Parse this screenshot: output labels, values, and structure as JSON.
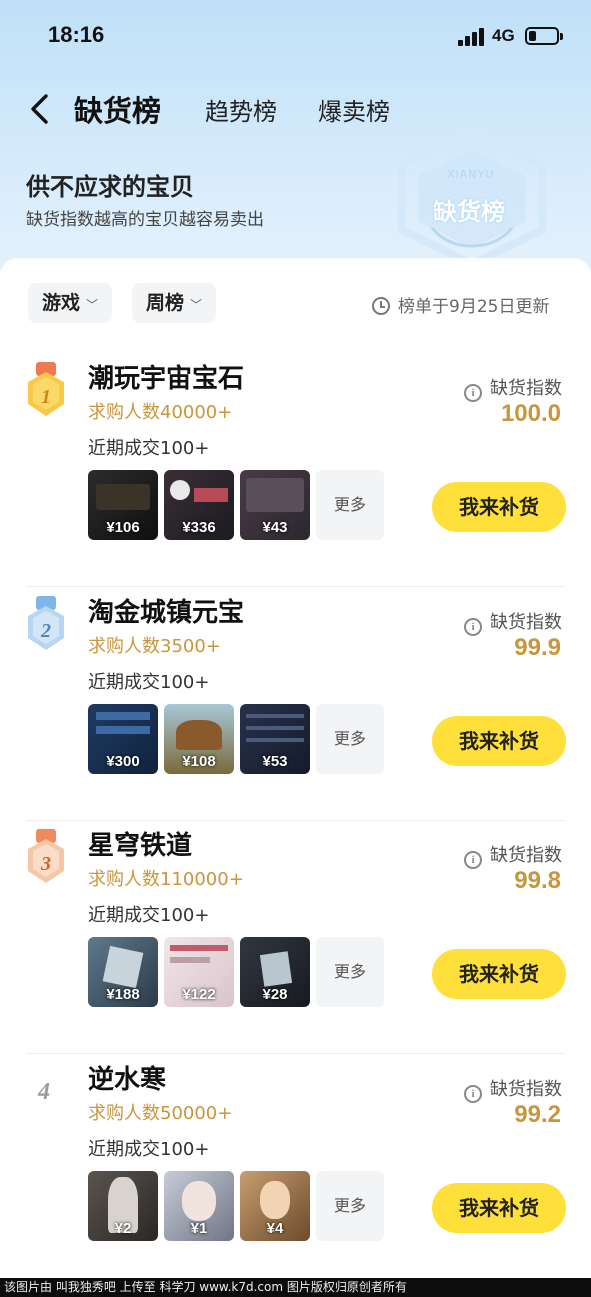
{
  "status_bar": {
    "time": "18:16",
    "network": "4G"
  },
  "nav": {
    "tabs": [
      {
        "label": "缺货榜",
        "active": true
      },
      {
        "label": "趋势榜",
        "active": false
      },
      {
        "label": "爆卖榜",
        "active": false
      }
    ]
  },
  "header": {
    "subtitle": "供不应求的宝贝",
    "description": "缺货指数越高的宝贝越容易卖出",
    "badge_label": "缺货榜",
    "badge_en": "XIANYU"
  },
  "filters": {
    "category": "游戏",
    "period": "周榜",
    "updated": "榜单于9月25日更新"
  },
  "index_label": "缺货指数",
  "more_label": "更多",
  "restock_label": "我来补货",
  "colors": {
    "accent": "#ffe03a",
    "gold": "#c9963e",
    "hero": "#bfe0f8"
  },
  "items": [
    {
      "rank": "1",
      "name": "潮玩宇宙宝石",
      "buyers": "求购人数40000+",
      "deals": "近期成交100+",
      "index": "100.0",
      "thumbs": [
        {
          "price": "¥106"
        },
        {
          "price": "¥336"
        },
        {
          "price": "¥43"
        }
      ]
    },
    {
      "rank": "2",
      "name": "淘金城镇元宝",
      "buyers": "求购人数3500+",
      "deals": "近期成交100+",
      "index": "99.9",
      "thumbs": [
        {
          "price": "¥300"
        },
        {
          "price": "¥108"
        },
        {
          "price": "¥53"
        }
      ]
    },
    {
      "rank": "3",
      "name": "星穹铁道",
      "buyers": "求购人数110000+",
      "deals": "近期成交100+",
      "index": "99.8",
      "thumbs": [
        {
          "price": "¥188"
        },
        {
          "price": "¥122"
        },
        {
          "price": "¥28"
        }
      ]
    },
    {
      "rank": "4",
      "name": "逆水寒",
      "buyers": "求购人数50000+",
      "deals": "近期成交100+",
      "index": "99.2",
      "thumbs": [
        {
          "price": "¥2"
        },
        {
          "price": "¥1"
        },
        {
          "price": "¥4"
        }
      ]
    }
  ],
  "watermark": "该图片由 叫我独秀吧 上传至 科学刀 www.k7d.com 图片版权归原创者所有"
}
